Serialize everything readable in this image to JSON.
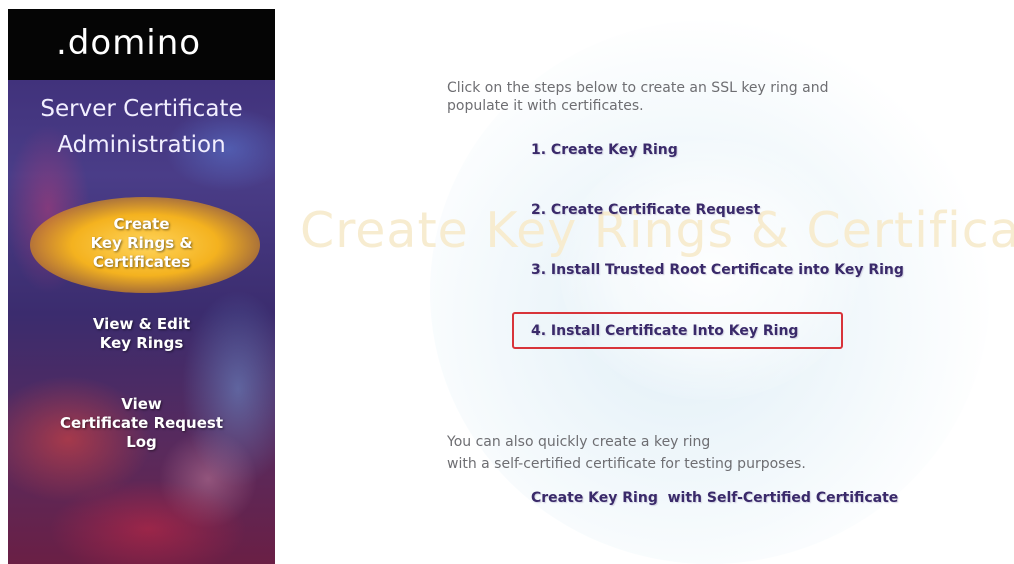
{
  "sidebar": {
    "logo": ".domino",
    "heading_lines": [
      "Server Certificate",
      "Administration"
    ],
    "items": [
      {
        "lines": [
          "Create",
          "Key Rings &",
          "Certificates"
        ],
        "selected": true
      },
      {
        "lines": [
          "View & Edit",
          "Key Rings"
        ],
        "selected": false
      },
      {
        "lines": [
          "View",
          "Certificate Request",
          "Log"
        ],
        "selected": false
      }
    ]
  },
  "main": {
    "watermark": "Create Key Rings & Certifica",
    "intro_lines": [
      "Click on the steps below to create an SSL key ring and",
      "populate it with certificates."
    ],
    "steps": [
      {
        "label": "1. Create Key Ring"
      },
      {
        "label": "2. Create Certificate Request"
      },
      {
        "label": "3. Install Trusted Root Certificate into Key Ring"
      },
      {
        "label": "4. Install Certificate Into Key Ring",
        "highlighted": true
      }
    ],
    "self_cert_lines": [
      "You can also quickly create a key ring",
      "with a self-certified certificate for testing purposes."
    ],
    "self_cert_link": "Create Key Ring  with Self-Certified Certificate"
  },
  "colors": {
    "sidebar_background": "#3a2a72",
    "selected_glow": "#f4b21f",
    "link_text": "#3a2a6a",
    "body_text": "#6e6e72",
    "highlight_border": "#d8343a",
    "watermark_text": "#f7ecd0"
  }
}
